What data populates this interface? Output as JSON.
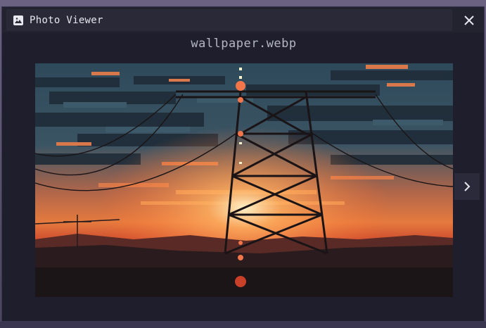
{
  "window": {
    "title": "Photo Viewer",
    "app_icon": "image-icon",
    "close_icon": "close-icon"
  },
  "viewer": {
    "filename": "wallpaper.webp",
    "next_icon": "chevron-right-icon",
    "image_subject": "pixel-art sunset with power line tower"
  },
  "colors": {
    "window_bg": "#1f1e2c",
    "titlebar_bg": "#23222f",
    "text": "#e6e6ee",
    "filename_text": "#b4b6c6"
  }
}
